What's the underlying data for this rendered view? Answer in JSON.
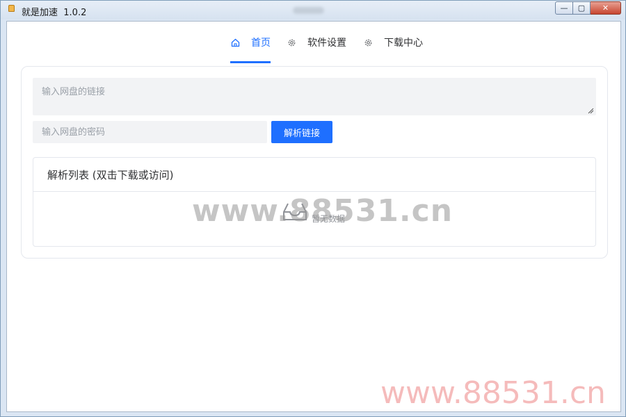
{
  "window": {
    "title": "就是加速  1.0.2",
    "controls": {
      "minimize": "—",
      "maximize": "▢",
      "close": "✕"
    }
  },
  "nav": {
    "tabs": [
      {
        "label": "首页",
        "icon": "home-icon",
        "active": true
      },
      {
        "label": "软件设置",
        "icon": "gear-icon",
        "active": false
      },
      {
        "label": "下载中心",
        "icon": "gear-icon",
        "active": false
      }
    ]
  },
  "form": {
    "link_placeholder": "输入网盘的链接",
    "link_value": "",
    "password_placeholder": "输入网盘的密码",
    "password_value": "",
    "parse_button": "解析链接"
  },
  "list": {
    "title": "解析列表 (双击下载或访问)",
    "empty_text": "暂无数据",
    "empty_icon": "inbox-icon"
  },
  "watermarks": {
    "center": "www.88531.cn",
    "corner": "www.88531.cn"
  },
  "colors": {
    "accent": "#1e6fff",
    "input_bg": "#f2f3f5",
    "border": "#e4e7ed"
  }
}
